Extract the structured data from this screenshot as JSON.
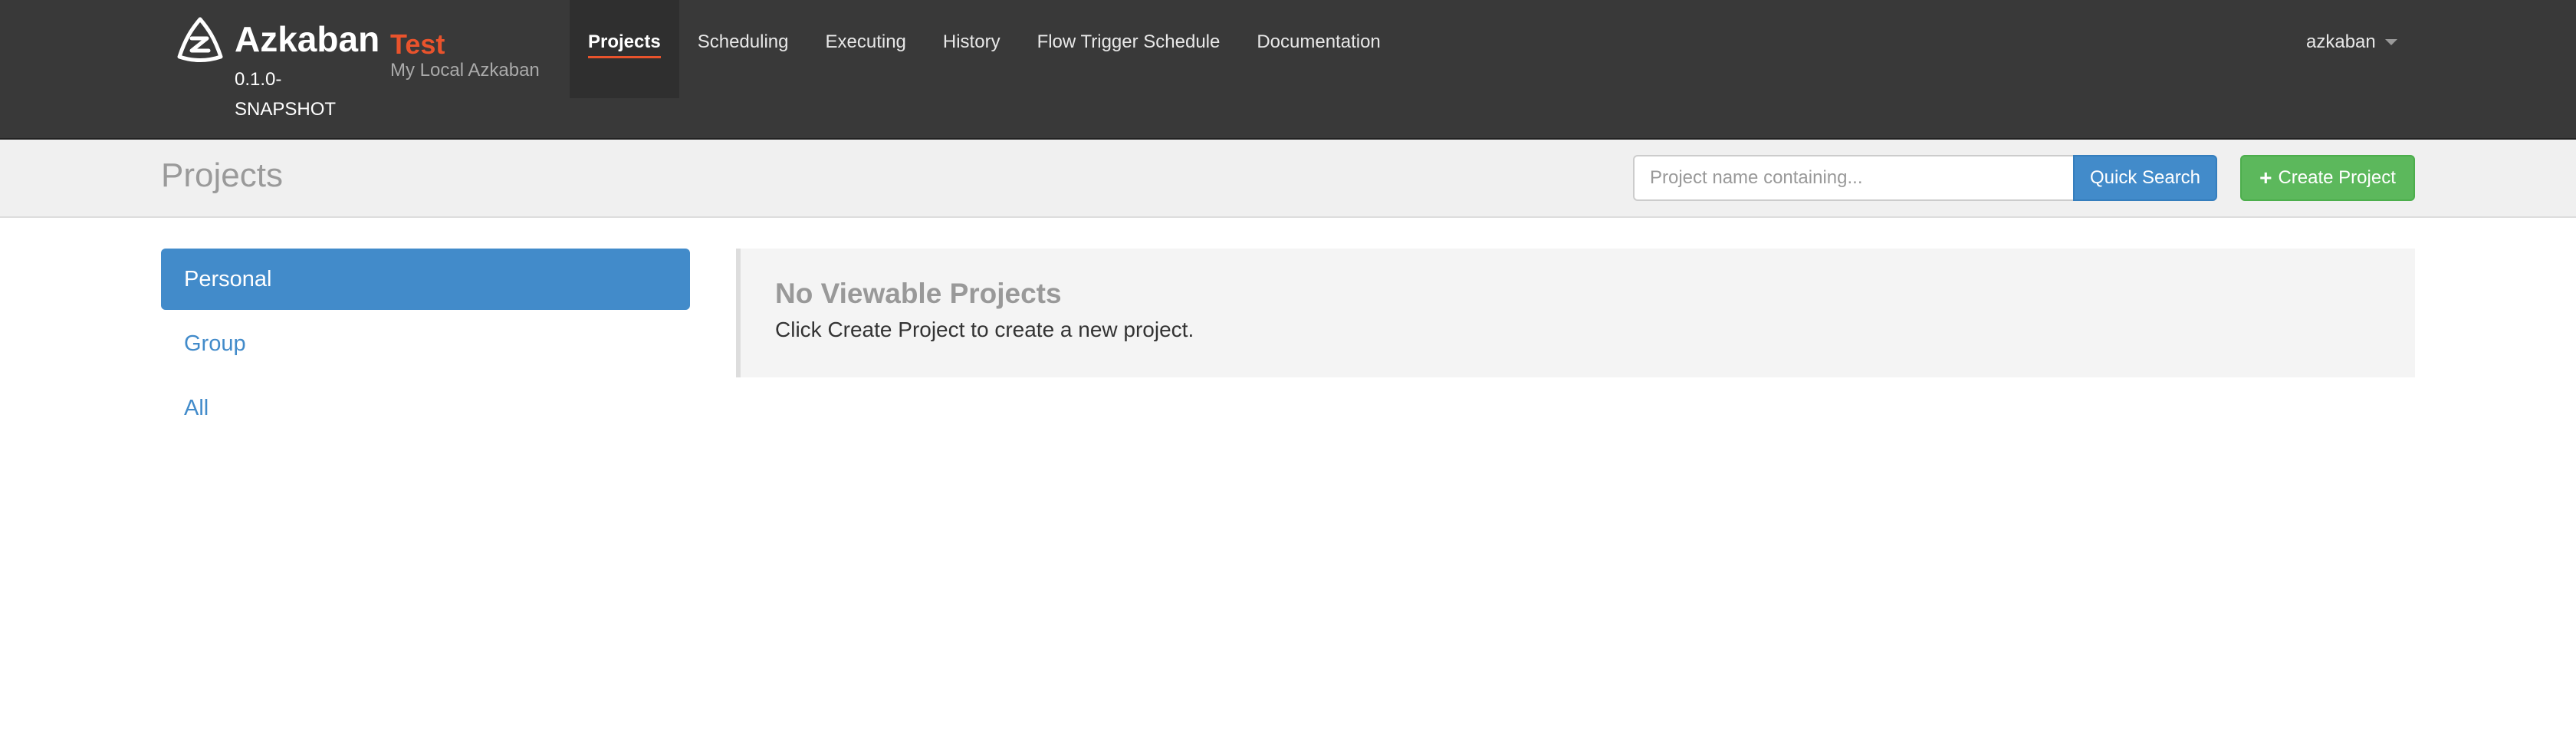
{
  "brand": {
    "name": "Azkaban",
    "version": "0.1.0-SNAPSHOT",
    "env_name": "Test",
    "env_desc": "My Local Azkaban",
    "logo_icon": "azkaban-logo-icon"
  },
  "nav": {
    "items": [
      {
        "label": "Projects",
        "active": true
      },
      {
        "label": "Scheduling"
      },
      {
        "label": "Executing"
      },
      {
        "label": "History"
      },
      {
        "label": "Flow Trigger Schedule"
      },
      {
        "label": "Documentation"
      }
    ],
    "user": "azkaban",
    "user_icon": "caret-down-icon"
  },
  "header": {
    "title": "Projects",
    "search_placeholder": "Project name containing...",
    "search_button": "Quick Search",
    "create_button": "Create Project",
    "create_icon": "plus-icon"
  },
  "sidebar": {
    "items": [
      {
        "label": "Personal",
        "active": true
      },
      {
        "label": "Group"
      },
      {
        "label": "All"
      }
    ]
  },
  "main": {
    "empty_title": "No Viewable Projects",
    "empty_text": "Click Create Project to create a new project."
  },
  "colors": {
    "navbar": "#393939",
    "accent": "#e9532c",
    "primary": "#428bca",
    "success": "#5cb85c"
  }
}
